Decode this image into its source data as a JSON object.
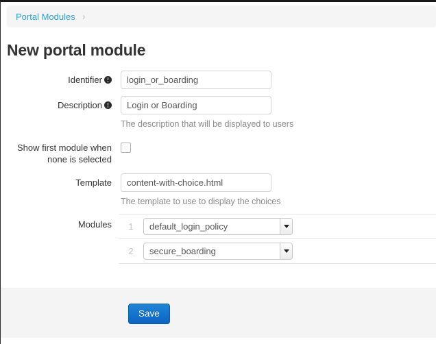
{
  "breadcrumb": {
    "link_label": "Portal Modules",
    "chevron": "chevron-right-icon",
    "chevron_glyph": "›"
  },
  "page_title": "New portal module",
  "form": {
    "identifier": {
      "label": "Identifier",
      "has_info_icon": true,
      "value": "login_or_boarding",
      "placeholder": ""
    },
    "description": {
      "label": "Description",
      "has_info_icon": true,
      "value": "Login or Boarding",
      "placeholder": "",
      "help": "The description that will be displayed to users"
    },
    "show_first_module": {
      "label": "Show first module when none is selected",
      "checked": false
    },
    "template": {
      "label": "Template",
      "value": "content-with-choice.html",
      "placeholder": "",
      "help": "The template to use to display the choices"
    },
    "modules": {
      "label": "Modules",
      "rows": [
        {
          "index": "1",
          "value": "default_login_policy"
        },
        {
          "index": "2",
          "value": "secure_boarding"
        }
      ]
    }
  },
  "actions": {
    "save_label": "Save"
  },
  "colors": {
    "link": "#27a4e0",
    "primary_button": "#0b63c4",
    "panel_background": "#f4f4f4",
    "breadcrumb_background": "#f5f5f5",
    "text": "#333333",
    "muted_text": "#8a8a8a"
  }
}
